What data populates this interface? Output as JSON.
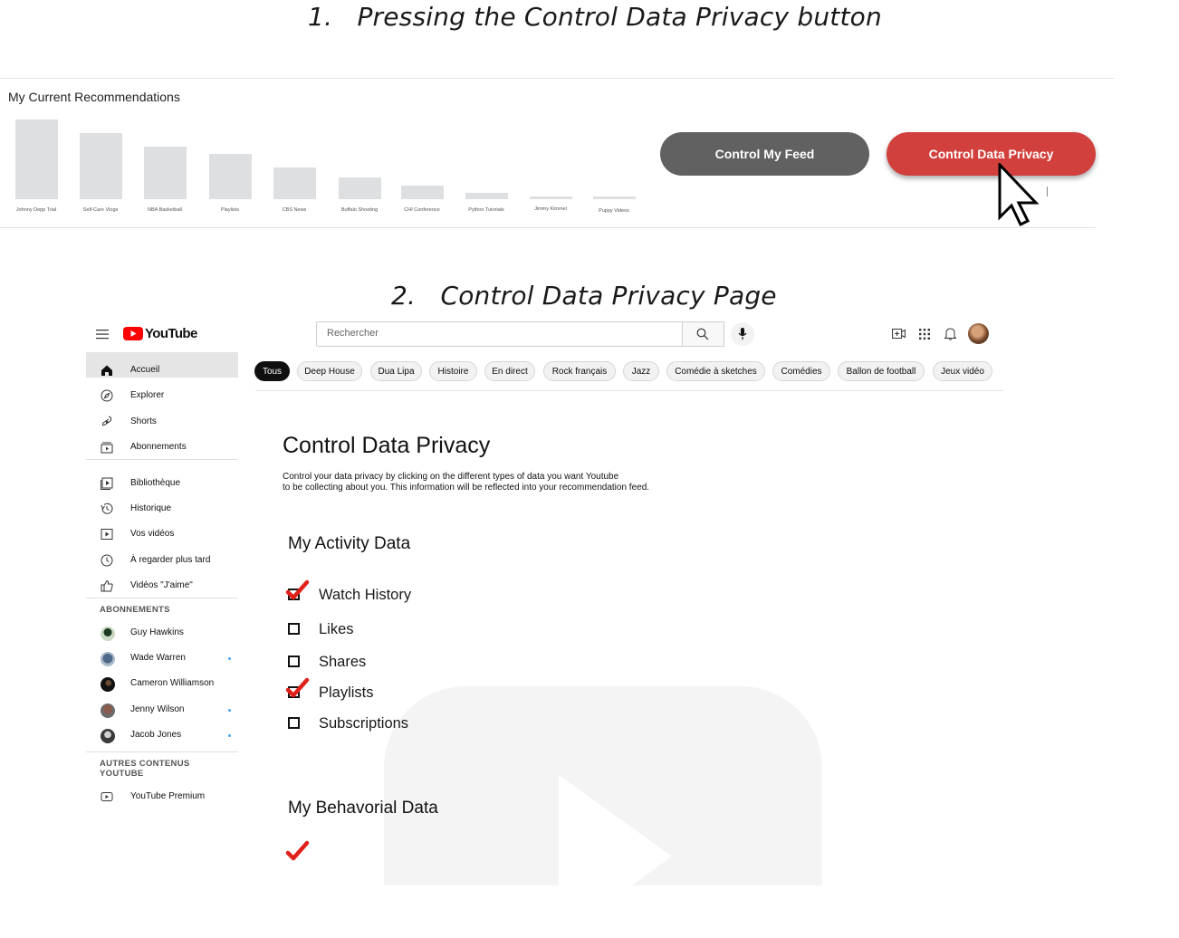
{
  "step1": {
    "number": "1.",
    "title": "Pressing the Control Data Privacy button"
  },
  "step2": {
    "number": "2.",
    "title": "Control Data Privacy Page"
  },
  "recommendations": {
    "title": "My Current Recommendations",
    "items": [
      {
        "label": "Johnny Depp Trial",
        "share": 1.0
      },
      {
        "label": "Self-Care Vlogs",
        "share": 0.83
      },
      {
        "label": "NBA Basketball",
        "share": 0.66
      },
      {
        "label": "Playlists",
        "share": 0.57
      },
      {
        "label": "CBS News",
        "share": 0.4
      },
      {
        "label": "Buffalo Shooting",
        "share": 0.27
      },
      {
        "label": "CHI Conference",
        "share": 0.17
      },
      {
        "label": "Python Tutorials",
        "share": 0.08
      },
      {
        "label": "Jimmy Kimmel",
        "share": 0.03
      },
      {
        "label": "Puppy Videos",
        "share": 0.03
      }
    ],
    "buttons": {
      "feed": "Control My Feed",
      "privacy": "Control Data Privacy"
    },
    "colors": {
      "feed": "#616161",
      "privacy": "#d1403c"
    }
  },
  "youtube": {
    "logo_text": "YouTube",
    "search_placeholder": "Rechercher",
    "nav": [
      "Accueil",
      "Explorer",
      "Shorts",
      "Abonnements",
      "Bibliothèque",
      "Historique",
      "Vos vidéos",
      "À regarder plus tard",
      "Vidéos \"J'aime\""
    ],
    "subscriptions_header": "ABONNEMENTS",
    "subscriptions": [
      {
        "name": "Guy Hawkins",
        "new": false
      },
      {
        "name": "Wade Warren",
        "new": true
      },
      {
        "name": "Cameron Williamson",
        "new": false
      },
      {
        "name": "Jenny Wilson",
        "new": true
      },
      {
        "name": "Jacob Jones",
        "new": true
      }
    ],
    "more_header_line1": "AUTRES CONTENUS",
    "more_header_line2": "YOUTUBE",
    "premium": "YouTube Premium",
    "chips": [
      "Tous",
      "Deep House",
      "Dua Lipa",
      "Histoire",
      "En direct",
      "Rock français",
      "Jazz",
      "Comédie à sketches",
      "Comédies",
      "Ballon de football",
      "Jeux vidéo"
    ]
  },
  "privacy": {
    "title": "Control Data Privacy",
    "desc_line1": "Control your data privacy by clicking on the different types of data you want Youtube",
    "desc_line2": "to be collecting about you. This information will be reflected into your recommendation feed.",
    "activity_title": "My Activity Data",
    "activity_items": [
      {
        "label": "Watch History",
        "checked": true
      },
      {
        "label": "Likes",
        "checked": false
      },
      {
        "label": "Shares",
        "checked": false
      },
      {
        "label": "Playlists",
        "checked": true
      },
      {
        "label": "Subscriptions",
        "checked": false
      }
    ],
    "behavioral_title": "My Behavorial Data"
  }
}
